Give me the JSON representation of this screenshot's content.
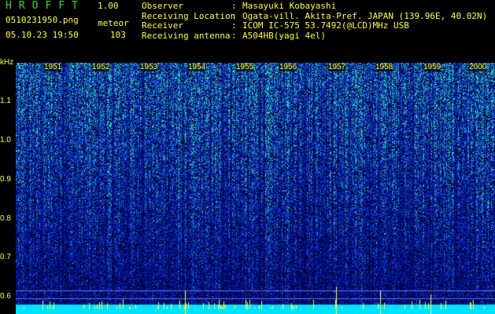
{
  "header": {
    "app_title": "HROFFT",
    "app_version": "1.00",
    "file_name": "0510231950.png",
    "meteor_label": "meteor",
    "datetime": "05.10.23 19:50",
    "meteor_count": "103"
  },
  "info": [
    {
      "key": "Observer",
      "value": "Masayuki Kobayashi"
    },
    {
      "key": "Receiving Location",
      "value": "Ogata-vill. Akita-Pref. JAPAN (139.96E, 40.02N)"
    },
    {
      "key": "Receiver",
      "value": "ICOM IC-575 53.7492(@LCD)MHz USB"
    },
    {
      "key": "Receiving antenna",
      "value": "A504HB(yagi 4el)"
    }
  ],
  "axis": {
    "unit": "kHz",
    "y_ticks": [
      "1.1",
      "1.0",
      "0.9",
      "0.8",
      "0.7",
      "0.6"
    ],
    "time_ticks": [
      "1951",
      "1952",
      "1953",
      "1954",
      "1955",
      "1956",
      "1957",
      "1958",
      "1959",
      "2000"
    ]
  },
  "colors": {
    "label": "#ffff40",
    "title": "#38d838",
    "background": "#000000"
  }
}
